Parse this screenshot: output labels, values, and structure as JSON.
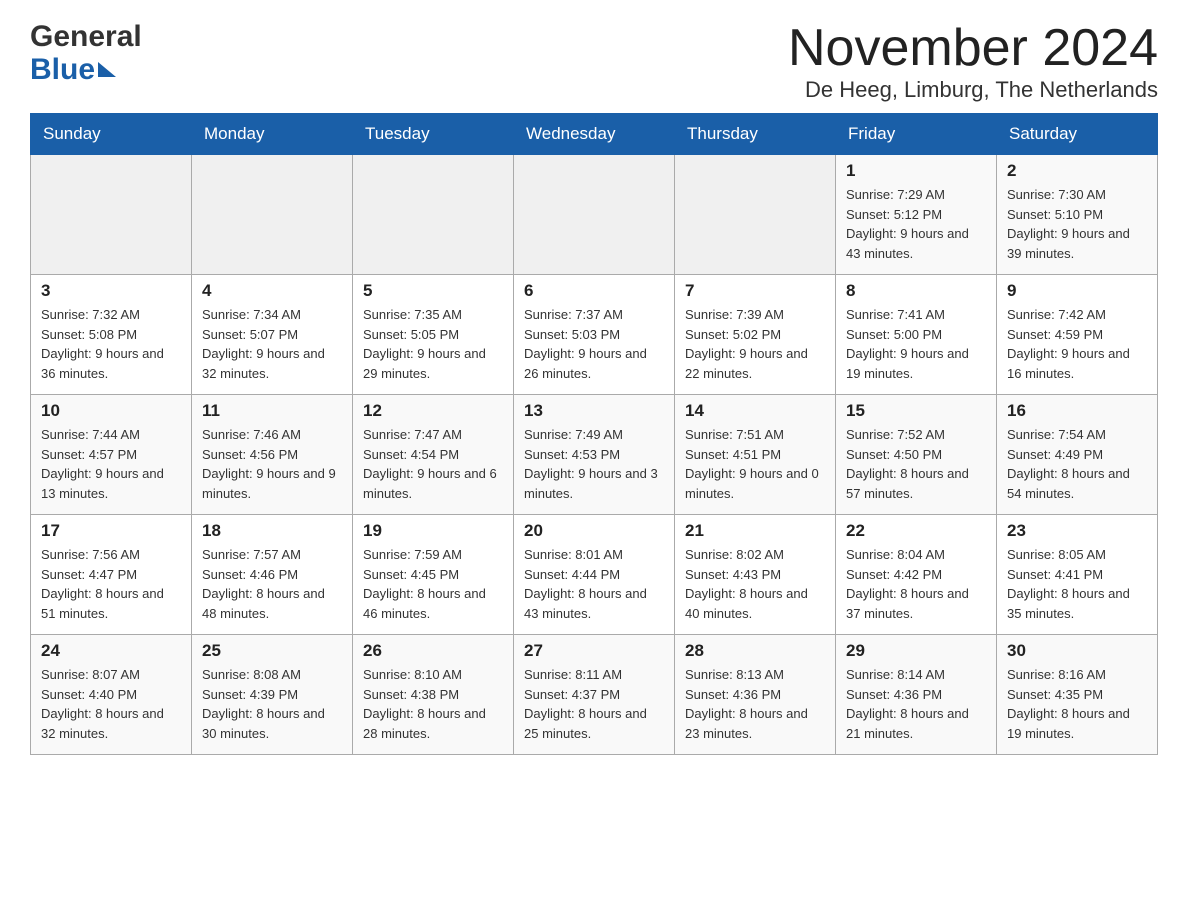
{
  "header": {
    "logo_general": "General",
    "logo_blue": "Blue",
    "month_title": "November 2024",
    "location": "De Heeg, Limburg, The Netherlands"
  },
  "weekdays": [
    "Sunday",
    "Monday",
    "Tuesday",
    "Wednesday",
    "Thursday",
    "Friday",
    "Saturday"
  ],
  "weeks": [
    [
      {
        "day": "",
        "info": ""
      },
      {
        "day": "",
        "info": ""
      },
      {
        "day": "",
        "info": ""
      },
      {
        "day": "",
        "info": ""
      },
      {
        "day": "",
        "info": ""
      },
      {
        "day": "1",
        "info": "Sunrise: 7:29 AM\nSunset: 5:12 PM\nDaylight: 9 hours and 43 minutes."
      },
      {
        "day": "2",
        "info": "Sunrise: 7:30 AM\nSunset: 5:10 PM\nDaylight: 9 hours and 39 minutes."
      }
    ],
    [
      {
        "day": "3",
        "info": "Sunrise: 7:32 AM\nSunset: 5:08 PM\nDaylight: 9 hours and 36 minutes."
      },
      {
        "day": "4",
        "info": "Sunrise: 7:34 AM\nSunset: 5:07 PM\nDaylight: 9 hours and 32 minutes."
      },
      {
        "day": "5",
        "info": "Sunrise: 7:35 AM\nSunset: 5:05 PM\nDaylight: 9 hours and 29 minutes."
      },
      {
        "day": "6",
        "info": "Sunrise: 7:37 AM\nSunset: 5:03 PM\nDaylight: 9 hours and 26 minutes."
      },
      {
        "day": "7",
        "info": "Sunrise: 7:39 AM\nSunset: 5:02 PM\nDaylight: 9 hours and 22 minutes."
      },
      {
        "day": "8",
        "info": "Sunrise: 7:41 AM\nSunset: 5:00 PM\nDaylight: 9 hours and 19 minutes."
      },
      {
        "day": "9",
        "info": "Sunrise: 7:42 AM\nSunset: 4:59 PM\nDaylight: 9 hours and 16 minutes."
      }
    ],
    [
      {
        "day": "10",
        "info": "Sunrise: 7:44 AM\nSunset: 4:57 PM\nDaylight: 9 hours and 13 minutes."
      },
      {
        "day": "11",
        "info": "Sunrise: 7:46 AM\nSunset: 4:56 PM\nDaylight: 9 hours and 9 minutes."
      },
      {
        "day": "12",
        "info": "Sunrise: 7:47 AM\nSunset: 4:54 PM\nDaylight: 9 hours and 6 minutes."
      },
      {
        "day": "13",
        "info": "Sunrise: 7:49 AM\nSunset: 4:53 PM\nDaylight: 9 hours and 3 minutes."
      },
      {
        "day": "14",
        "info": "Sunrise: 7:51 AM\nSunset: 4:51 PM\nDaylight: 9 hours and 0 minutes."
      },
      {
        "day": "15",
        "info": "Sunrise: 7:52 AM\nSunset: 4:50 PM\nDaylight: 8 hours and 57 minutes."
      },
      {
        "day": "16",
        "info": "Sunrise: 7:54 AM\nSunset: 4:49 PM\nDaylight: 8 hours and 54 minutes."
      }
    ],
    [
      {
        "day": "17",
        "info": "Sunrise: 7:56 AM\nSunset: 4:47 PM\nDaylight: 8 hours and 51 minutes."
      },
      {
        "day": "18",
        "info": "Sunrise: 7:57 AM\nSunset: 4:46 PM\nDaylight: 8 hours and 48 minutes."
      },
      {
        "day": "19",
        "info": "Sunrise: 7:59 AM\nSunset: 4:45 PM\nDaylight: 8 hours and 46 minutes."
      },
      {
        "day": "20",
        "info": "Sunrise: 8:01 AM\nSunset: 4:44 PM\nDaylight: 8 hours and 43 minutes."
      },
      {
        "day": "21",
        "info": "Sunrise: 8:02 AM\nSunset: 4:43 PM\nDaylight: 8 hours and 40 minutes."
      },
      {
        "day": "22",
        "info": "Sunrise: 8:04 AM\nSunset: 4:42 PM\nDaylight: 8 hours and 37 minutes."
      },
      {
        "day": "23",
        "info": "Sunrise: 8:05 AM\nSunset: 4:41 PM\nDaylight: 8 hours and 35 minutes."
      }
    ],
    [
      {
        "day": "24",
        "info": "Sunrise: 8:07 AM\nSunset: 4:40 PM\nDaylight: 8 hours and 32 minutes."
      },
      {
        "day": "25",
        "info": "Sunrise: 8:08 AM\nSunset: 4:39 PM\nDaylight: 8 hours and 30 minutes."
      },
      {
        "day": "26",
        "info": "Sunrise: 8:10 AM\nSunset: 4:38 PM\nDaylight: 8 hours and 28 minutes."
      },
      {
        "day": "27",
        "info": "Sunrise: 8:11 AM\nSunset: 4:37 PM\nDaylight: 8 hours and 25 minutes."
      },
      {
        "day": "28",
        "info": "Sunrise: 8:13 AM\nSunset: 4:36 PM\nDaylight: 8 hours and 23 minutes."
      },
      {
        "day": "29",
        "info": "Sunrise: 8:14 AM\nSunset: 4:36 PM\nDaylight: 8 hours and 21 minutes."
      },
      {
        "day": "30",
        "info": "Sunrise: 8:16 AM\nSunset: 4:35 PM\nDaylight: 8 hours and 19 minutes."
      }
    ]
  ]
}
